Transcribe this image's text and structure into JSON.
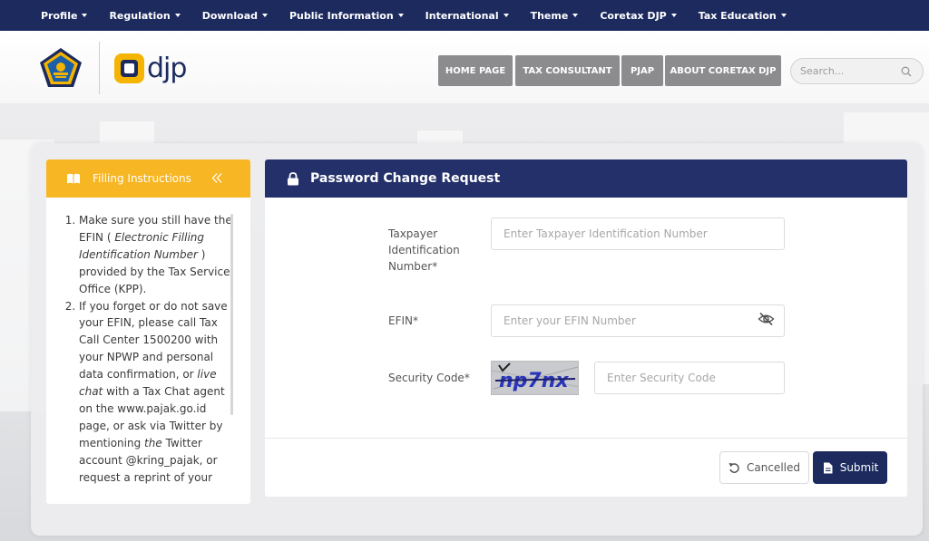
{
  "nav": {
    "items": [
      {
        "label": "Profile"
      },
      {
        "label": "Regulation"
      },
      {
        "label": "Download"
      },
      {
        "label": "Public Information"
      },
      {
        "label": "International"
      },
      {
        "label": "Theme"
      },
      {
        "label": "Coretax DJP"
      },
      {
        "label": "Tax Education"
      }
    ]
  },
  "header": {
    "logo_text": "djp",
    "buttons": [
      {
        "label": "HOME PAGE"
      },
      {
        "label": "TAX CONSULTANT"
      },
      {
        "label": "PJAP"
      },
      {
        "label": "ABOUT CORETAX DJP"
      }
    ],
    "search_placeholder": "Search..."
  },
  "instructions": {
    "title": "Filling Instructions",
    "items": [
      {
        "pre": "Make sure you still have the EFIN ( ",
        "em": "Electronic Filling Identification Number",
        "post": " ) provided by the Tax Service Office (KPP)."
      },
      {
        "pre": "If you forget or do not save your EFIN, please call Tax Call Center 1500200 with your NPWP and personal data confirmation, or ",
        "em": "live chat",
        "mid": " with a Tax Chat agent on the www.pajak.go.id page, or ask via Twitter by mentioning ",
        "em2": "the",
        "post": " Twitter account @kring_pajak, or request a reprint of your"
      }
    ]
  },
  "form": {
    "title": "Password Change Request",
    "tin_label": "Taxpayer Identification Number*",
    "tin_placeholder": "Enter Taxpayer Identification Number",
    "efin_label": "EFIN*",
    "efin_placeholder": "Enter your EFIN Number",
    "security_label": "Security Code*",
    "security_placeholder": "Enter Security Code",
    "captcha_text": "np7nx",
    "cancel_label": "Cancelled",
    "submit_label": "Submit"
  },
  "colors": {
    "nav_bg": "#1c2a5e",
    "accent_yellow": "#f7b624",
    "form_header": "#24306a",
    "header_button": "#8c8c8f"
  }
}
